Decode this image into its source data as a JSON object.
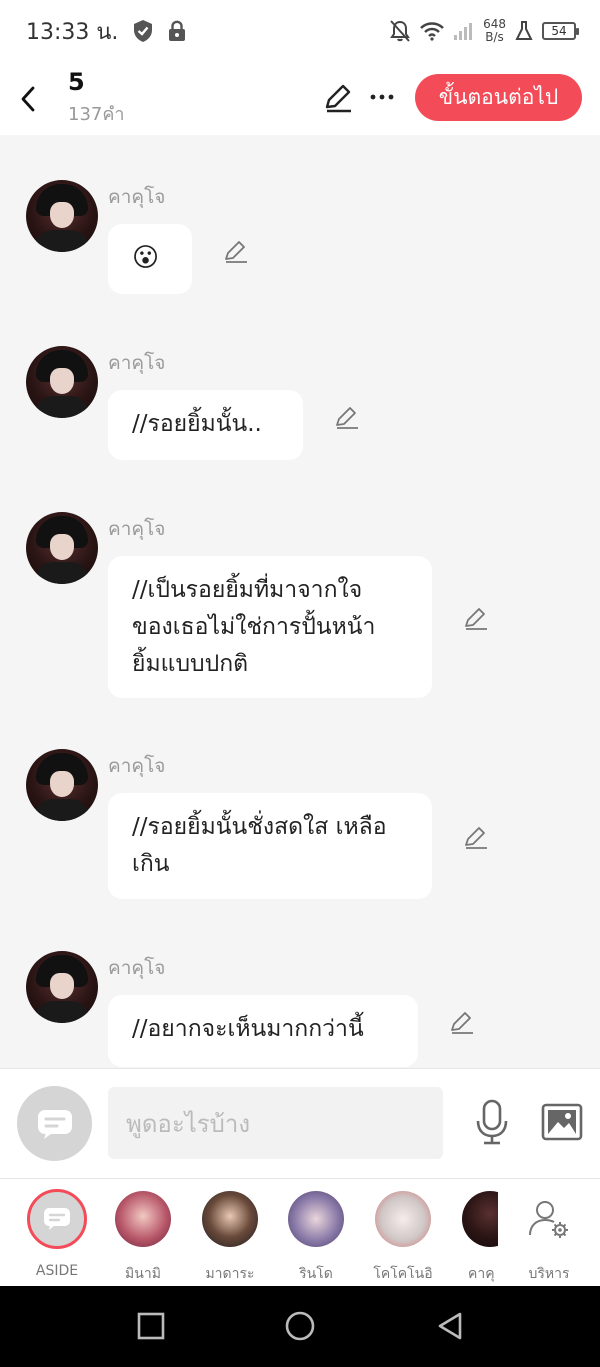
{
  "status_bar": {
    "time": "13:33 น.",
    "net_speed_value": "648",
    "net_speed_unit": "B/s",
    "battery": "54"
  },
  "header": {
    "title": "5",
    "subtitle": "137คำ",
    "next_button": "ขั้นตอนต่อไป"
  },
  "messages": [
    {
      "sender": "คาคุโจ",
      "text": "😮"
    },
    {
      "sender": "คาคุโจ",
      "text": "//รอยยิ้มนั้น.."
    },
    {
      "sender": "คาคุโจ",
      "text": "//เป็นรอยยิ้มที่มาจากใจ ของเธอไม่ใช่การปั้นหน้า ยิ้มแบบปกติ"
    },
    {
      "sender": "คาคุโจ",
      "text": "//รอยยิ้มนั้นชั่งสดใส เหลือเกิน"
    },
    {
      "sender": "คาคุโจ",
      "text": "//อยากจะเห็นมากกว่านี้"
    }
  ],
  "input": {
    "placeholder": "พูดอะไรบ้าง"
  },
  "characters": [
    {
      "label": "ASIDE"
    },
    {
      "label": "มินามิ"
    },
    {
      "label": "มาดาระ"
    },
    {
      "label": "รินโด"
    },
    {
      "label": "โคโคโนอิ"
    },
    {
      "label": "คาคุ"
    },
    {
      "label": "บริหาร"
    }
  ],
  "colors": {
    "accent": "#f34b57",
    "background": "#f5f5f5"
  }
}
